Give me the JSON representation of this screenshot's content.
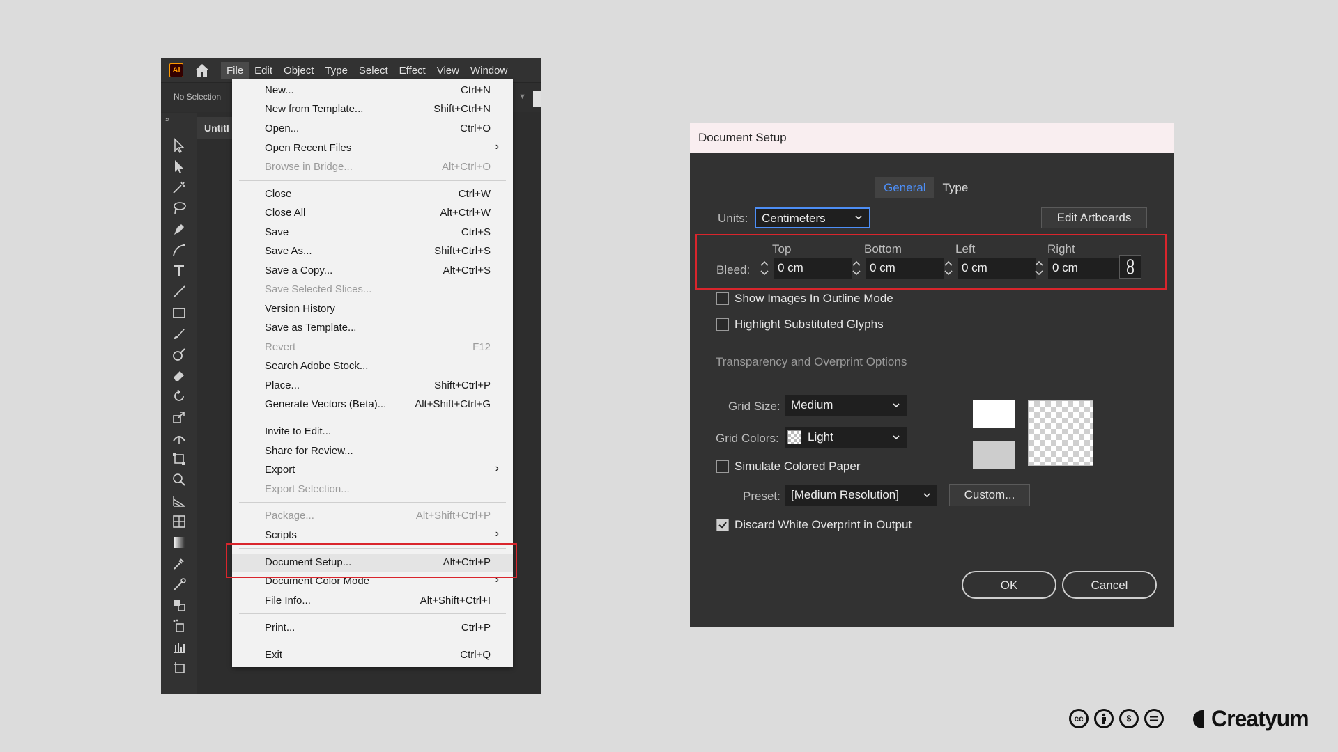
{
  "app": {
    "logo": "Ai",
    "menu": [
      "File",
      "Edit",
      "Object",
      "Type",
      "Select",
      "Effect",
      "View",
      "Window"
    ],
    "no_selection": "No Selection",
    "doc_tab": "Untitl"
  },
  "file_menu": {
    "items": [
      {
        "label": "New...",
        "shortcut": "Ctrl+N"
      },
      {
        "label": "New from Template...",
        "shortcut": "Shift+Ctrl+N"
      },
      {
        "label": "Open...",
        "shortcut": "Ctrl+O"
      },
      {
        "label": "Open Recent Files",
        "shortcut": ""
      },
      {
        "label": "Browse in Bridge...",
        "shortcut": "Alt+Ctrl+O"
      },
      {
        "label": "Close",
        "shortcut": "Ctrl+W"
      },
      {
        "label": "Close All",
        "shortcut": "Alt+Ctrl+W"
      },
      {
        "label": "Save",
        "shortcut": "Ctrl+S"
      },
      {
        "label": "Save As...",
        "shortcut": "Shift+Ctrl+S"
      },
      {
        "label": "Save a Copy...",
        "shortcut": "Alt+Ctrl+S"
      },
      {
        "label": "Save Selected Slices...",
        "shortcut": ""
      },
      {
        "label": "Version History",
        "shortcut": ""
      },
      {
        "label": "Save as Template...",
        "shortcut": ""
      },
      {
        "label": "Revert",
        "shortcut": "F12"
      },
      {
        "label": "Search Adobe Stock...",
        "shortcut": ""
      },
      {
        "label": "Place...",
        "shortcut": "Shift+Ctrl+P"
      },
      {
        "label": "Generate Vectors (Beta)...",
        "shortcut": "Alt+Shift+Ctrl+G"
      },
      {
        "label": "Invite to Edit...",
        "shortcut": ""
      },
      {
        "label": "Share for Review...",
        "shortcut": ""
      },
      {
        "label": "Export",
        "shortcut": ""
      },
      {
        "label": "Export Selection...",
        "shortcut": ""
      },
      {
        "label": "Package...",
        "shortcut": "Alt+Shift+Ctrl+P"
      },
      {
        "label": "Scripts",
        "shortcut": ""
      },
      {
        "label": "Document Setup...",
        "shortcut": "Alt+Ctrl+P"
      },
      {
        "label": "Document Color Mode",
        "shortcut": ""
      },
      {
        "label": "File Info...",
        "shortcut": "Alt+Shift+Ctrl+I"
      },
      {
        "label": "Print...",
        "shortcut": "Ctrl+P"
      },
      {
        "label": "Exit",
        "shortcut": "Ctrl+Q"
      }
    ]
  },
  "dialog": {
    "title": "Document Setup",
    "tabs": [
      "General",
      "Type"
    ],
    "units_label": "Units:",
    "units_value": "Centimeters",
    "edit_artboards": "Edit Artboards",
    "bleed_label": "Bleed:",
    "bleed_headers": [
      "Top",
      "Bottom",
      "Left",
      "Right"
    ],
    "bleed_values": [
      "0 cm",
      "0 cm",
      "0 cm",
      "0 cm"
    ],
    "show_images_outline": "Show Images In Outline Mode",
    "highlight_glyphs": "Highlight Substituted Glyphs",
    "transparency_section": "Transparency and Overprint Options",
    "grid_size_label": "Grid Size:",
    "grid_size_value": "Medium",
    "grid_colors_label": "Grid Colors:",
    "grid_colors_value": "Light",
    "simulate_paper": "Simulate Colored Paper",
    "preset_label": "Preset:",
    "preset_value": "[Medium Resolution]",
    "custom_button": "Custom...",
    "discard_overprint": "Discard White Overprint in Output",
    "ok": "OK",
    "cancel": "Cancel"
  },
  "footer": {
    "brand": "Creatyum"
  },
  "colors": {
    "accent": "#4d8ef6",
    "highlight_red": "#d9252c",
    "dark_ui": "#323232"
  }
}
